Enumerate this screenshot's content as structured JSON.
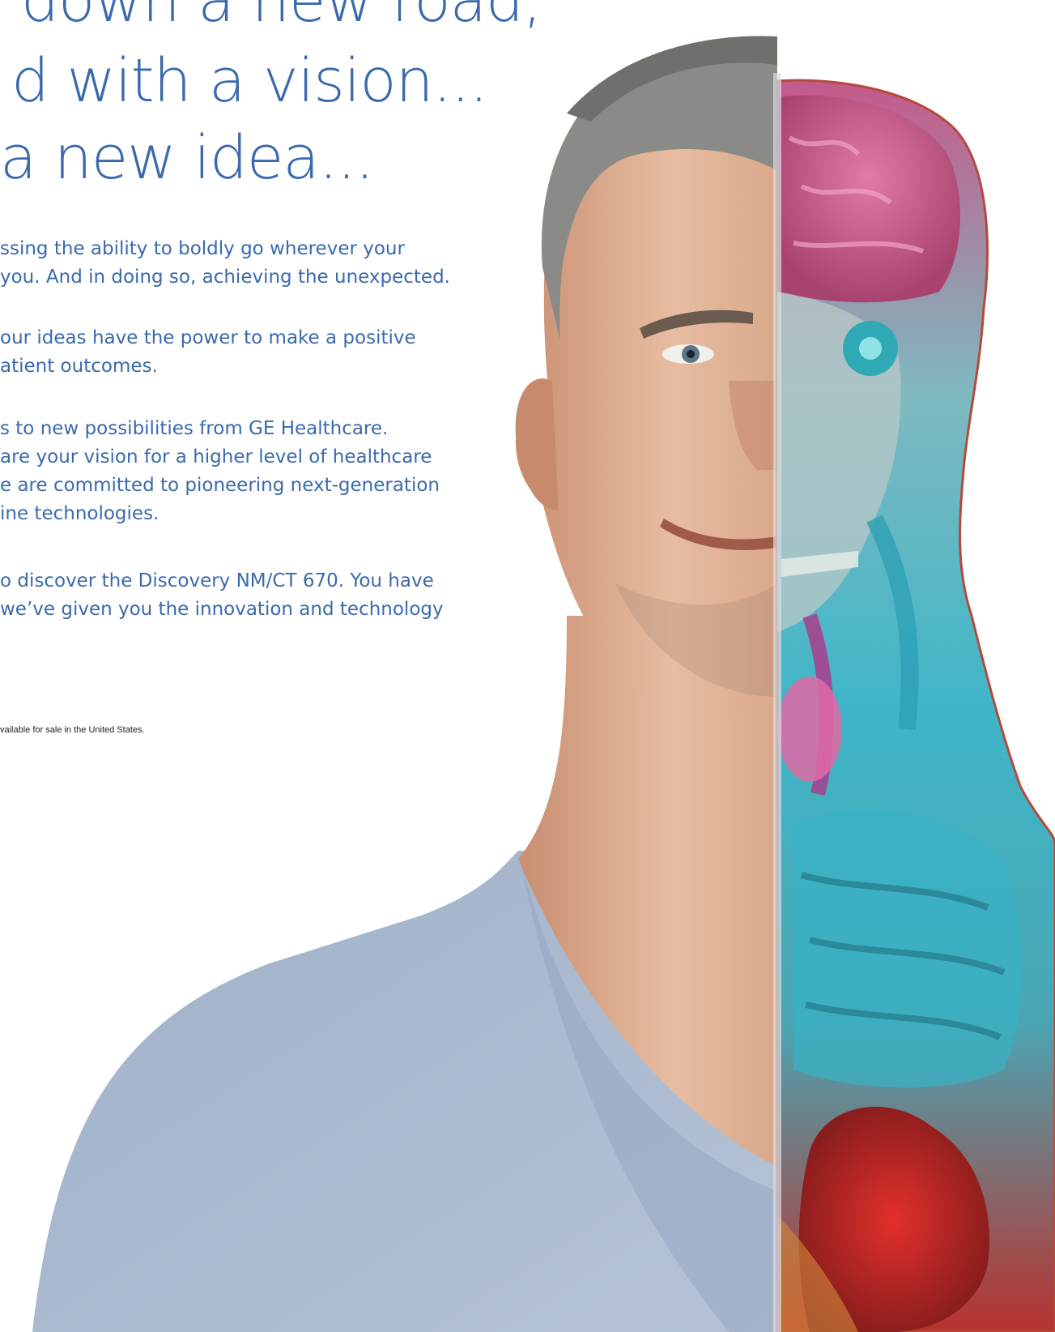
{
  "headline": {
    "line1": "down a new road,",
    "line2": "d with a vision...",
    "line3": "a new idea..."
  },
  "paragraphs": [
    {
      "line1": "ssing the ability to boldly go wherever your",
      "line2": "you. And in doing so, achieving the unexpected."
    },
    {
      "line1": "our ideas have the power to make a positive",
      "line2": "atient outcomes."
    },
    {
      "line1": "s to new possibilities from GE Healthcare.",
      "line2": "are your vision for a higher level of healthcare",
      "line3": "e are committed to pioneering next-generation",
      "line4": "ine technologies."
    },
    {
      "line1": "o discover the Discovery NM/CT 670. You have",
      "line2": "we’ve given you the innovation and technology"
    }
  ],
  "footnote": "vailable for sale in the United States.",
  "colors": {
    "text_blue": "#3a6aad",
    "shirt": "#aab7cd",
    "skin": "#d9a88a",
    "hair": "#8a8a86"
  }
}
